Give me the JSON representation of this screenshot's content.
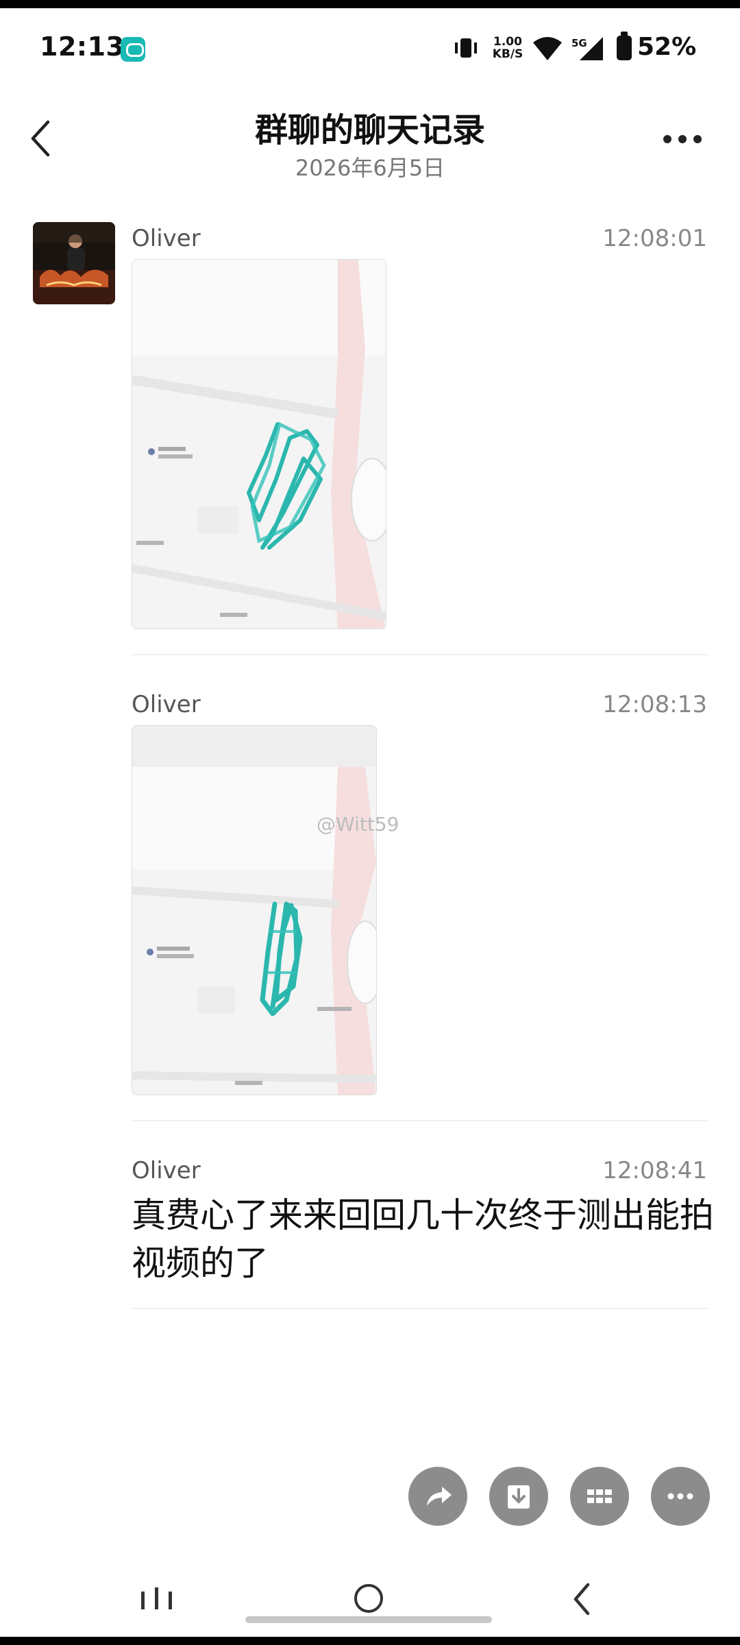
{
  "status_bar": {
    "time": "12:13",
    "net_speed_value": "1.00",
    "net_speed_unit": "KB/S",
    "network_type": "5G",
    "battery": "52%",
    "app_icon": "teal-app-icon"
  },
  "header": {
    "title": "群聊的聊天记录",
    "date": "2026年6月5日",
    "back_icon": "chevron-left-icon",
    "more_icon": "more-dots-icon"
  },
  "messages": [
    {
      "sender": "Oliver",
      "time": "12:08:01",
      "type": "image",
      "content": "map-track-screenshot"
    },
    {
      "sender": "Oliver",
      "time": "12:08:13",
      "type": "image",
      "content": "map-track-screenshot"
    },
    {
      "sender": "Oliver",
      "time": "12:08:41",
      "type": "text",
      "text": "真费心了来来回回几十次终于测出能拍视频的了"
    }
  ],
  "watermark": "@Witt59",
  "actions": [
    {
      "name": "share",
      "icon": "share-icon"
    },
    {
      "name": "download",
      "icon": "download-icon"
    },
    {
      "name": "grid",
      "icon": "grid-icon"
    },
    {
      "name": "more",
      "icon": "more-dots-icon"
    }
  ],
  "nav_bar": [
    "recents-icon",
    "home-icon",
    "back-icon"
  ]
}
